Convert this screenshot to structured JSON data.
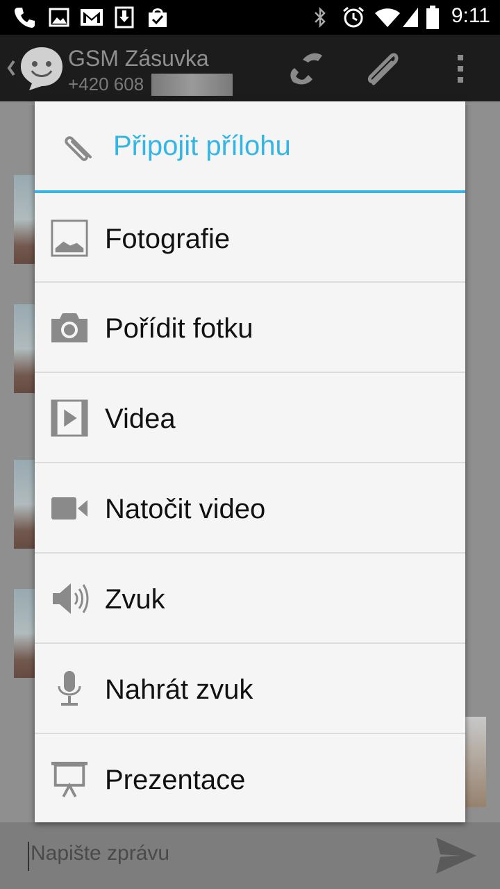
{
  "status_bar": {
    "time": "9:11",
    "left_icons": [
      "phone-icon",
      "gallery-icon",
      "gmail-icon",
      "download-icon",
      "shopping-bag-icon"
    ],
    "right_icons": [
      "bluetooth-icon",
      "alarm-icon",
      "wifi-icon",
      "signal-icon",
      "battery-icon"
    ]
  },
  "action_bar": {
    "contact_name": "GSM Zásuvka",
    "contact_number": "+420 608",
    "actions": [
      "call-icon",
      "attach-icon",
      "overflow-menu-icon"
    ]
  },
  "dialog": {
    "title": "Připojit přílohu",
    "title_icon": "paperclip-icon",
    "accent_color": "#33b5e5",
    "items": [
      {
        "label": "Fotografie",
        "icon": "photo-icon"
      },
      {
        "label": "Pořídit fotku",
        "icon": "camera-icon"
      },
      {
        "label": "Videa",
        "icon": "video-icon"
      },
      {
        "label": "Natočit video",
        "icon": "video-camera-icon"
      },
      {
        "label": "Zvuk",
        "icon": "speaker-icon"
      },
      {
        "label": "Nahrát zvuk",
        "icon": "microphone-icon"
      },
      {
        "label": "Prezentace",
        "icon": "presentation-icon"
      }
    ]
  },
  "composer": {
    "placeholder": "Napište zprávu"
  }
}
